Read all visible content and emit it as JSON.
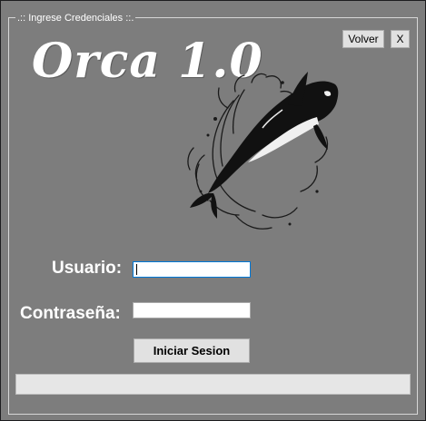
{
  "login": {
    "group_title": ".:: Ingrese Credenciales ::.",
    "back_label": "Volver",
    "close_label": "X",
    "app_title": "Orca 1.0",
    "user_label": "Usuario:",
    "user_value": "",
    "password_label": "Contraseña:",
    "password_value": "",
    "submit_label": "Iniciar Sesion",
    "progress_fraction": 0
  },
  "colors": {
    "background": "#7d7d7d",
    "text": "#ffffff",
    "focus_border": "#0078d7",
    "button_face": "#e1e1e1"
  },
  "icons": {
    "logo_art": "orca-whale-splash-icon"
  }
}
